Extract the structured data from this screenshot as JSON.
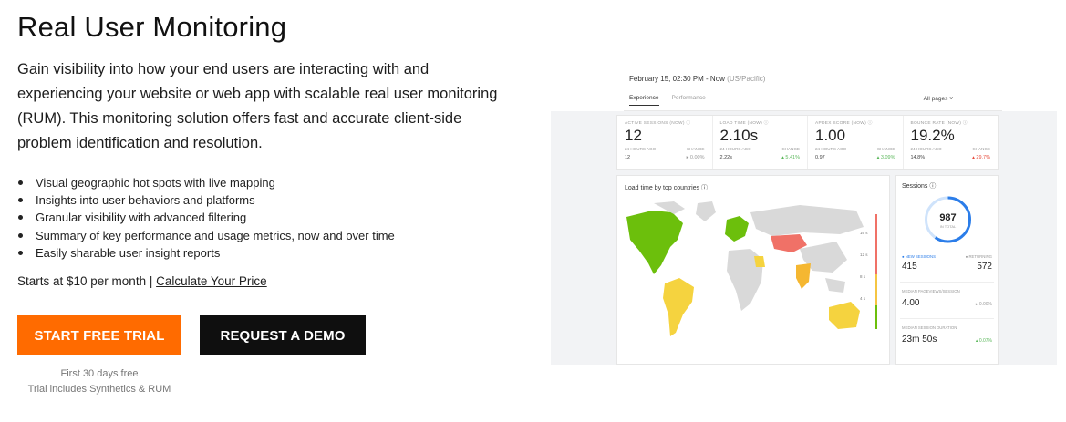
{
  "hero": {
    "title": "Real User Monitoring",
    "intro": "Gain visibility into how your end users are interacting with and experiencing your website or web app with scalable real user monitoring (RUM). This monitoring solution offers fast and accurate client-side problem identification and resolution.",
    "bullets": [
      "Visual geographic hot spots with live mapping",
      "Insights into user behaviors and platforms",
      "Granular visibility with advanced filtering",
      "Summary of key performance and usage metrics, now and over time",
      "Easily sharable user insight reports"
    ],
    "price_text": "Starts at $10 per month |",
    "price_link": "Calculate Your Price",
    "trial_button": "START FREE TRIAL",
    "demo_button": "REQUEST A DEMO",
    "fine_print_1": "First 30 days free",
    "fine_print_2": "Trial includes Synthetics & RUM"
  },
  "dashboard": {
    "date": "February 15, 02:30 PM - Now",
    "timezone": "(US/Pacific)",
    "tabs": [
      "Experience",
      "Performance"
    ],
    "filter": "All pages  ˅",
    "kpis": [
      {
        "label": "ACTIVE SESSIONS (NOW) ⓘ",
        "value": "12",
        "sub": "24 HOURS AGO",
        "prev": "12",
        "change_label": "CHANGE",
        "change": "▸ 0.00%",
        "change_color": "#999999"
      },
      {
        "label": "LOAD TIME (NOW) ⓘ",
        "value": "2.10s",
        "sub": "24 HOURS AGO",
        "prev": "2.22s",
        "change_label": "CHANGE",
        "change": "▴ 5.41%",
        "change_color": "#5cb85c"
      },
      {
        "label": "APDEX SCORE (NOW) ⓘ",
        "value": "1.00",
        "sub": "24 HOURS AGO",
        "prev": "0.97",
        "change_label": "CHANGE",
        "change": "▴ 3.09%",
        "change_color": "#5cb85c"
      },
      {
        "label": "BOUNCE RATE (NOW) ⓘ",
        "value": "19.2%",
        "sub": "24 HOURS AGO",
        "prev": "14.8%",
        "change_label": "CHANGE",
        "change": "▴ 29.7%",
        "change_color": "#e74c3c"
      }
    ],
    "map_title": "Load time by top countries ⓘ",
    "scale_labels": [
      "16 s",
      "12 s",
      "8 s",
      "4 s"
    ],
    "sessions": {
      "title": "Sessions ⓘ",
      "total": "987",
      "total_label": "IN TOTAL",
      "new_label": "● NEW SESSIONS",
      "new_value": "415",
      "returning_label": "● RETURNING",
      "returning_value": "572",
      "pageviews_label": "MEDIAN PAGEVIEWS/SESSION",
      "pageviews_value": "4.00",
      "pageviews_change": "▸ 0.00%",
      "duration_label": "MEDIAN SESSION DURATION",
      "duration_value": "23m 50s",
      "duration_change": "▴ 0.07%"
    },
    "colors": {
      "accent_orange": "#ff6b00",
      "ring_blue": "#2b7de9",
      "good": "#6cbf0c",
      "warn": "#f5c542",
      "bad": "#f07167"
    }
  }
}
